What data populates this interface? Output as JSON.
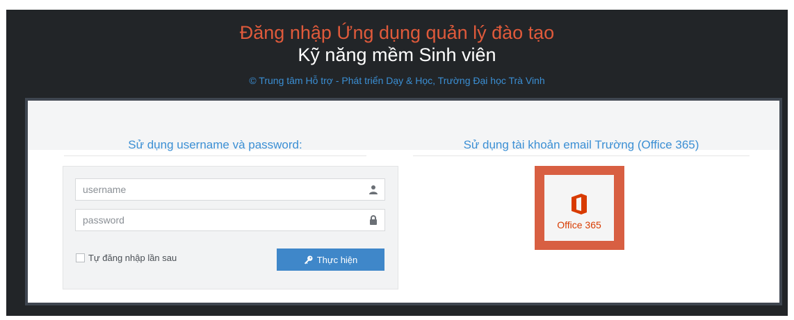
{
  "header": {
    "title_line1": "Đăng nhập Ứng dụng quản lý đào tạo",
    "title_line2": "Kỹ năng mềm Sinh viên",
    "copyright": "© Trung tâm Hỗ trợ - Phát triển Dạy & Học, Trường Đại học Trà Vinh"
  },
  "left_column": {
    "heading": "Sử dụng username và password:",
    "username_placeholder": "username",
    "password_placeholder": "password",
    "remember_label": "Tự đăng nhập lần sau",
    "submit_label": "Thực hiện"
  },
  "right_column": {
    "heading": "Sử dụng tài khoản email Trường (Office 365)",
    "office_logo_text": "Office 365"
  },
  "colors": {
    "title_red": "#e05a3b",
    "accent_blue": "#3b8fd4",
    "button_blue": "#3f87c9",
    "office_orange": "#d83b01",
    "background_dark": "#222528"
  },
  "icons": {
    "username": "user-icon",
    "password": "lock-icon",
    "submit": "key-icon",
    "office": "office-logo-icon"
  }
}
